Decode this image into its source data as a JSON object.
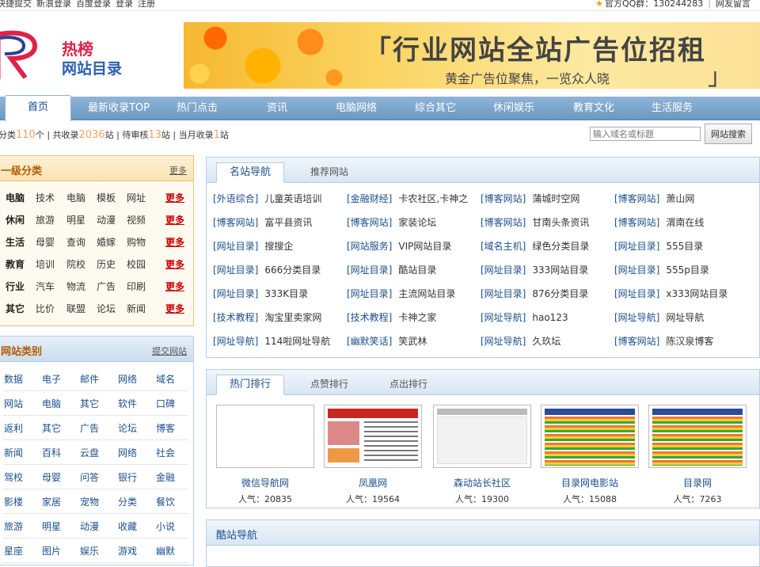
{
  "topbar": {
    "links": [
      "快捷提交",
      "新浪登录",
      "百度登录",
      "登录",
      "注册"
    ],
    "qq_group": "官方QQ群：130244283",
    "guestbook": "网友留言"
  },
  "logo": {
    "line1": "热榜",
    "line2": "网站目录"
  },
  "banner": {
    "title": "「行业网站全站广告位招租",
    "subtitle": "黄金广告位聚焦，一览众人晓"
  },
  "nav": {
    "home": "首页",
    "items": [
      "最新收录TOP",
      "热门点击",
      "资讯",
      "电脑网络",
      "综合其它",
      "休闲娱乐",
      "教育文化",
      "生活服务"
    ]
  },
  "stats": {
    "p1": "分类",
    "n1": "110",
    "p2": "个 | 共收录",
    "n2": "2036",
    "p3": "站 | 待审核",
    "n3": "13",
    "p4": "站 | 当月收录",
    "n4": "1",
    "p5": "站"
  },
  "search": {
    "placeholder": "输入域名或标题",
    "button": "网站搜索"
  },
  "category_box": {
    "title": "一级分类",
    "more": "更多",
    "rows": [
      {
        "head": "电脑",
        "items": [
          "技术",
          "电脑",
          "模板",
          "网址"
        ],
        "more": "更多"
      },
      {
        "head": "休闲",
        "items": [
          "旅游",
          "明星",
          "动漫",
          "视频"
        ],
        "more": "更多"
      },
      {
        "head": "生活",
        "items": [
          "母婴",
          "查询",
          "婚嫁",
          "购物"
        ],
        "more": "更多"
      },
      {
        "head": "教育",
        "items": [
          "培训",
          "院校",
          "历史",
          "校园"
        ],
        "more": "更多"
      },
      {
        "head": "行业",
        "items": [
          "汽车",
          "物流",
          "广告",
          "印刷"
        ],
        "more": "更多"
      },
      {
        "head": "其它",
        "items": [
          "比价",
          "联盟",
          "论坛",
          "新闻"
        ],
        "more": "更多"
      }
    ]
  },
  "site_type_box": {
    "title": "网站类别",
    "more": "提交网站",
    "rows": [
      [
        "数据",
        "电子",
        "邮件",
        "网络",
        "域名"
      ],
      [
        "网站",
        "电脑",
        "其它",
        "软件",
        "口碑"
      ],
      [
        "返利",
        "其它",
        "广告",
        "论坛",
        "博客"
      ],
      [
        "新闻",
        "百科",
        "云盘",
        "网络",
        "社会"
      ],
      [
        "驾校",
        "母婴",
        "问答",
        "银行",
        "金融"
      ],
      [
        "影楼",
        "家居",
        "宠物",
        "分类",
        "餐饮"
      ],
      [
        "旅游",
        "明星",
        "动漫",
        "收藏",
        "小说"
      ],
      [
        "星座",
        "图片",
        "娱乐",
        "游戏",
        "幽默"
      ]
    ]
  },
  "nav_panel": {
    "tabs": [
      "名站导航",
      "推荐网站"
    ],
    "rows": [
      [
        [
          "[外语综合]",
          "儿童英语培训"
        ],
        [
          "[金融财经]",
          "卡农社区,卡神之"
        ],
        [
          "[博客网站]",
          "蒲城时空网"
        ],
        [
          "[博客网站]",
          "萧山网"
        ]
      ],
      [
        [
          "[博客网站]",
          "富平县资讯"
        ],
        [
          "[博客网站]",
          "家装论坛"
        ],
        [
          "[博客网站]",
          "甘南头条资讯"
        ],
        [
          "[博客网站]",
          "渭南在线"
        ]
      ],
      [
        [
          "[网址目录]",
          "搜搜企"
        ],
        [
          "[网站服务]",
          "VIP网站目录"
        ],
        [
          "[域名主机]",
          "绿色分类目录"
        ],
        [
          "[网址目录]",
          "555目录"
        ]
      ],
      [
        [
          "[网址目录]",
          "666分类目录"
        ],
        [
          "[网址目录]",
          "酷站目录"
        ],
        [
          "[网址目录]",
          "333网站目录"
        ],
        [
          "[网址目录]",
          "555p目录"
        ]
      ],
      [
        [
          "[网址目录]",
          "333K目录"
        ],
        [
          "[网址目录]",
          "主流网站目录"
        ],
        [
          "[网址目录]",
          "876分类目录"
        ],
        [
          "[网址目录]",
          "x333网站目录"
        ]
      ],
      [
        [
          "[技术教程]",
          "淘宝里卖家网"
        ],
        [
          "[技术教程]",
          "卡神之家"
        ],
        [
          "[网址导航]",
          "hao123"
        ],
        [
          "[网址导航]",
          "网址导航"
        ]
      ],
      [
        [
          "[网址导航]",
          "114啦网址导航"
        ],
        [
          "[幽默笑话]",
          "笑武林"
        ],
        [
          "[网址导航]",
          "久玖坛"
        ],
        [
          "[博客网站]",
          "陈汉泉博客"
        ]
      ]
    ]
  },
  "hot_panel": {
    "tabs": [
      "热门排行",
      "点赞排行",
      "点出排行"
    ],
    "pop_label": "人气：",
    "items": [
      {
        "name": "微信导航网",
        "pop": "20835"
      },
      {
        "name": "凤凰网",
        "pop": "19564"
      },
      {
        "name": "森动站长社区",
        "pop": "19300"
      },
      {
        "name": "目录网电影站",
        "pop": "15088"
      },
      {
        "name": "目录网",
        "pop": "7263"
      }
    ]
  },
  "cool_panel": {
    "title": "酷站导航"
  },
  "colors": {
    "accent_orange": "#f5a25d",
    "link_blue": "#1b4f8c",
    "more_red": "#cc0000",
    "nav_blue": "#7ba4cb"
  }
}
